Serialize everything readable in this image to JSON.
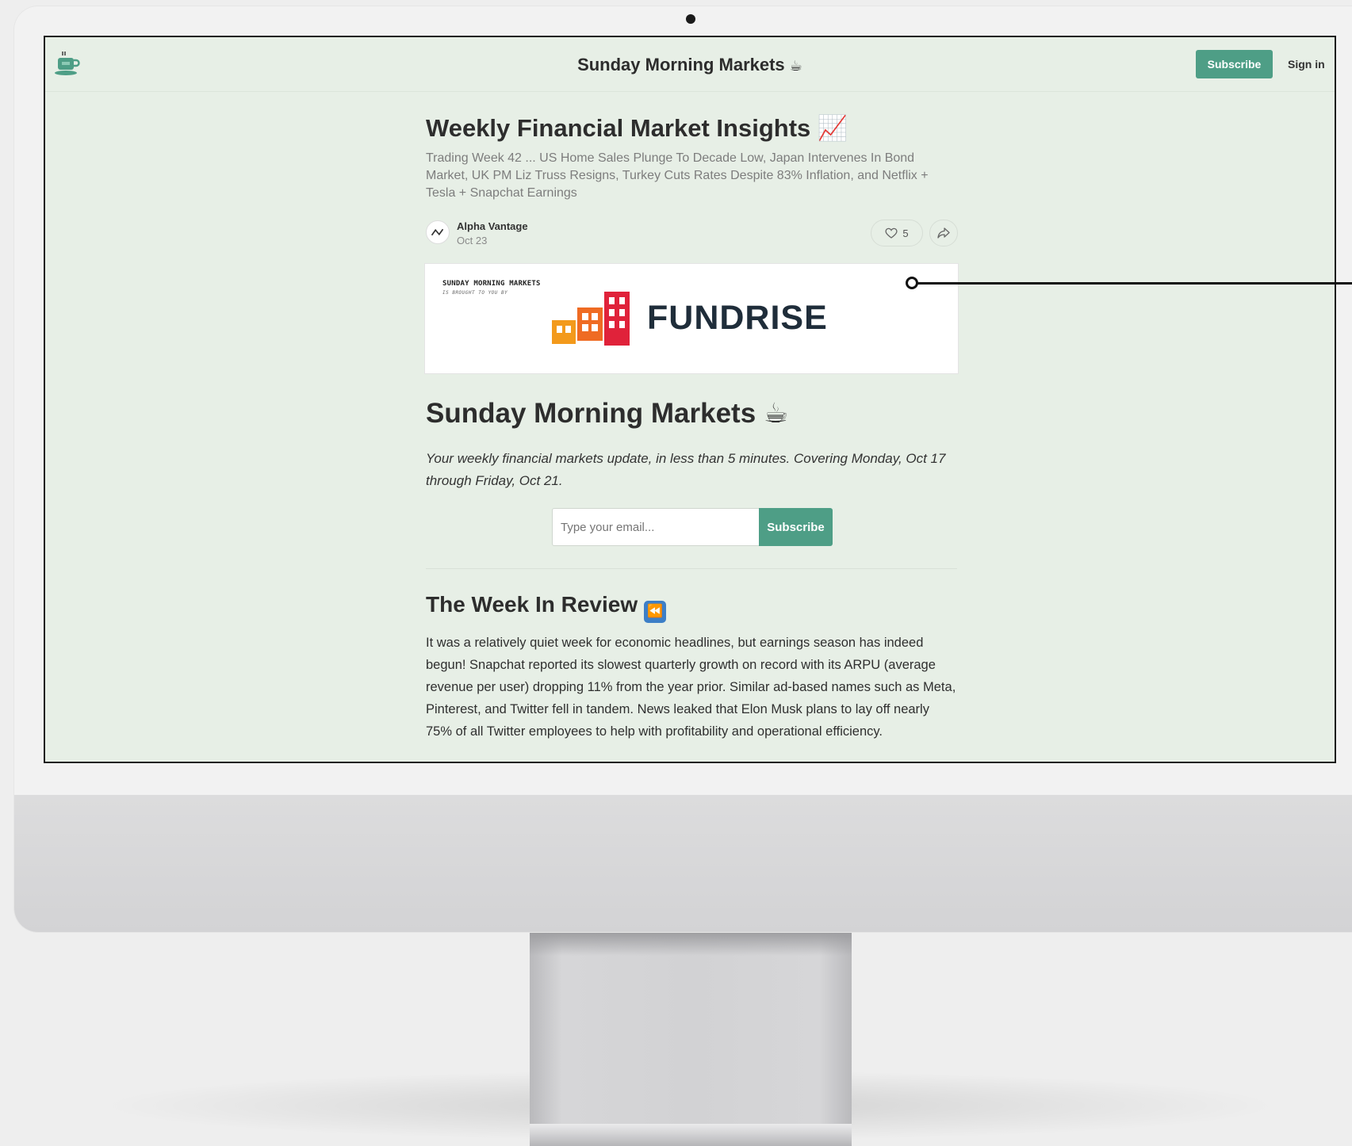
{
  "header": {
    "site_title": "Sunday Morning Markets",
    "site_emoji": "☕",
    "subscribe_label": "Subscribe",
    "signin_label": "Sign in",
    "logo_icon": "coffee-cup-icon"
  },
  "post": {
    "title": "Weekly Financial Market Insights",
    "title_emoji": "📈",
    "subtitle": "Trading Week 42 ... US Home Sales Plunge To Decade Low, Japan Intervenes In Bond Market, UK PM Liz Truss Resigns, Turkey Cuts Rates Despite 83% Inflation, and Netflix + Tesla + Snapchat Earnings",
    "author": "Alpha Vantage",
    "date": "Oct 23",
    "likes": "5"
  },
  "banner": {
    "line1": "SUNDAY MORNING MARKETS",
    "line2": "IS BROUGHT TO YOU BY",
    "sponsor": "FUNDRISE",
    "colors": {
      "orange": "#f39a1c",
      "red": "#e0223a",
      "text": "#1f2d3a"
    }
  },
  "content": {
    "heading": "Sunday Morning Markets",
    "heading_emoji": "☕",
    "intro": "Your weekly financial markets update, in less than 5 minutes. Covering Monday, Oct 17 through Friday, Oct 21.",
    "email_placeholder": "Type your email...",
    "email_button": "Subscribe",
    "section_heading": "The Week In Review",
    "section_emoji": "⏪",
    "section_body": "It was a relatively quiet week for economic headlines, but earnings season has indeed begun! Snapchat reported its slowest quarterly growth on record with its ARPU (average revenue per user) dropping 11% from the year prior. Similar ad-based names such as Meta, Pinterest, and Twitter fell in tandem. News leaked that Elon Musk plans to lay off nearly 75% of all Twitter employees to help with profitability and operational efficiency."
  },
  "theme": {
    "accent": "#4e9e86",
    "page_bg": "#e7efe6"
  }
}
